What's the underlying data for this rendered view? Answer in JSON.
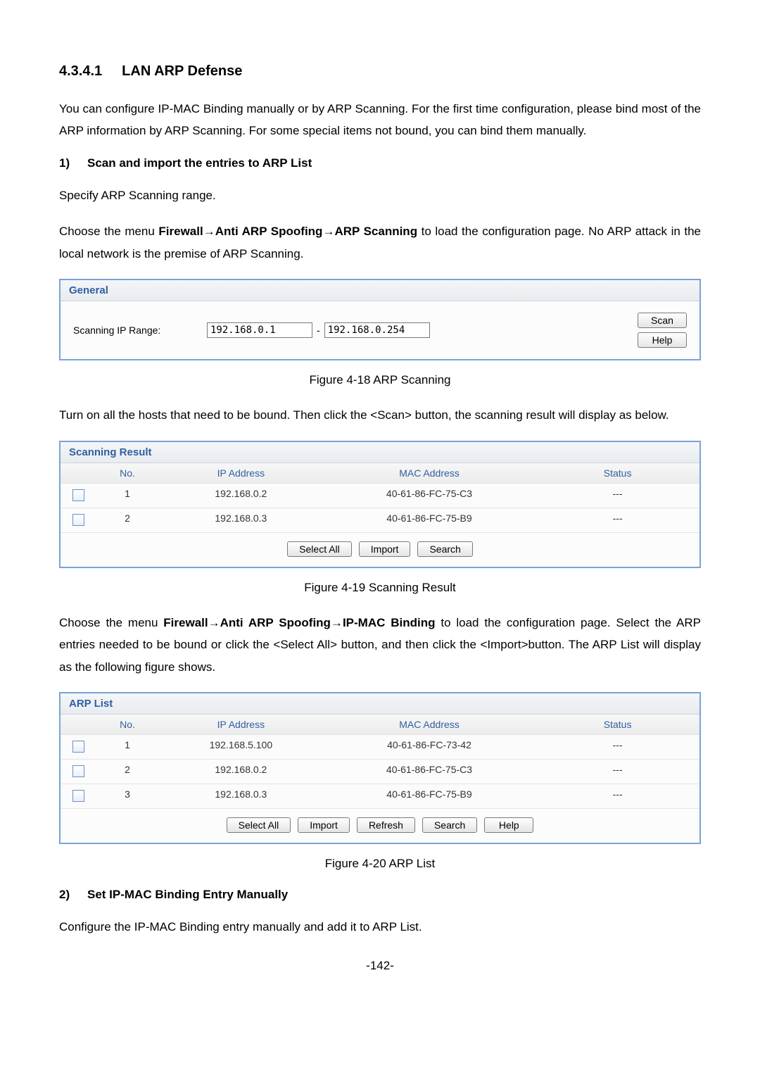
{
  "section": {
    "number": "4.3.4.1",
    "title": "LAN ARP Defense"
  },
  "para_intro": "You can configure IP-MAC Binding manually or by ARP Scanning. For the first time configuration, please bind most of the ARP information by ARP Scanning. For some special items not bound, you can bind them manually.",
  "step1": {
    "num": "1)",
    "title": "Scan and import the entries to ARP List"
  },
  "para_specify": "Specify ARP Scanning range.",
  "para_choose_scanning_pre": "Choose the menu ",
  "nav_firewall": "Firewall",
  "nav_arrow": "→",
  "nav_anti_arp": "Anti ARP Spoofing",
  "nav_scanning": "ARP Scanning",
  "para_choose_scanning_post": " to load the configuration page. No ARP attack in the local network is the premise of ARP Scanning.",
  "general_panel": {
    "title": "General",
    "label": "Scanning IP Range:",
    "ip_from": "192.168.0.1",
    "dash": "-",
    "ip_to": "192.168.0.254",
    "scan_btn": "Scan",
    "help_btn": "Help"
  },
  "caption_418": "Figure 4-18 ARP Scanning",
  "para_turn_on": "Turn on all the hosts that need to be bound. Then click the <Scan> button, the scanning result will display as below.",
  "result_panel": {
    "title": "Scanning Result",
    "columns": {
      "no": "No.",
      "ip": "IP Address",
      "mac": "MAC Address",
      "status": "Status"
    },
    "rows": [
      {
        "no": "1",
        "ip": "192.168.0.2",
        "mac": "40-61-86-FC-75-C3",
        "status": "---"
      },
      {
        "no": "2",
        "ip": "192.168.0.3",
        "mac": "40-61-86-FC-75-B9",
        "status": "---"
      }
    ],
    "buttons": {
      "select_all": "Select All",
      "import": "Import",
      "search": "Search"
    }
  },
  "caption_419": "Figure 4-19 Scanning Result",
  "para_choose_binding_pre": "Choose the menu ",
  "nav_binding": "IP-MAC Binding",
  "para_choose_binding_post": " to load the configuration page. Select the ARP entries needed to be bound or click the <Select All> button, and then click the <Import>button. The ARP List will display as the following figure shows.",
  "arp_panel": {
    "title": "ARP List",
    "columns": {
      "no": "No.",
      "ip": "IP Address",
      "mac": "MAC Address",
      "status": "Status"
    },
    "rows": [
      {
        "no": "1",
        "ip": "192.168.5.100",
        "mac": "40-61-86-FC-73-42",
        "status": "---"
      },
      {
        "no": "2",
        "ip": "192.168.0.2",
        "mac": "40-61-86-FC-75-C3",
        "status": "---"
      },
      {
        "no": "3",
        "ip": "192.168.0.3",
        "mac": "40-61-86-FC-75-B9",
        "status": "---"
      }
    ],
    "buttons": {
      "select_all": "Select All",
      "import": "Import",
      "refresh": "Refresh",
      "search": "Search",
      "help": "Help"
    }
  },
  "caption_420": "Figure 4-20 ARP List",
  "step2": {
    "num": "2)",
    "title": "Set IP-MAC Binding Entry Manually"
  },
  "para_configure_manual": "Configure the IP-MAC Binding entry manually and add it to ARP List.",
  "page_number": "-142-"
}
